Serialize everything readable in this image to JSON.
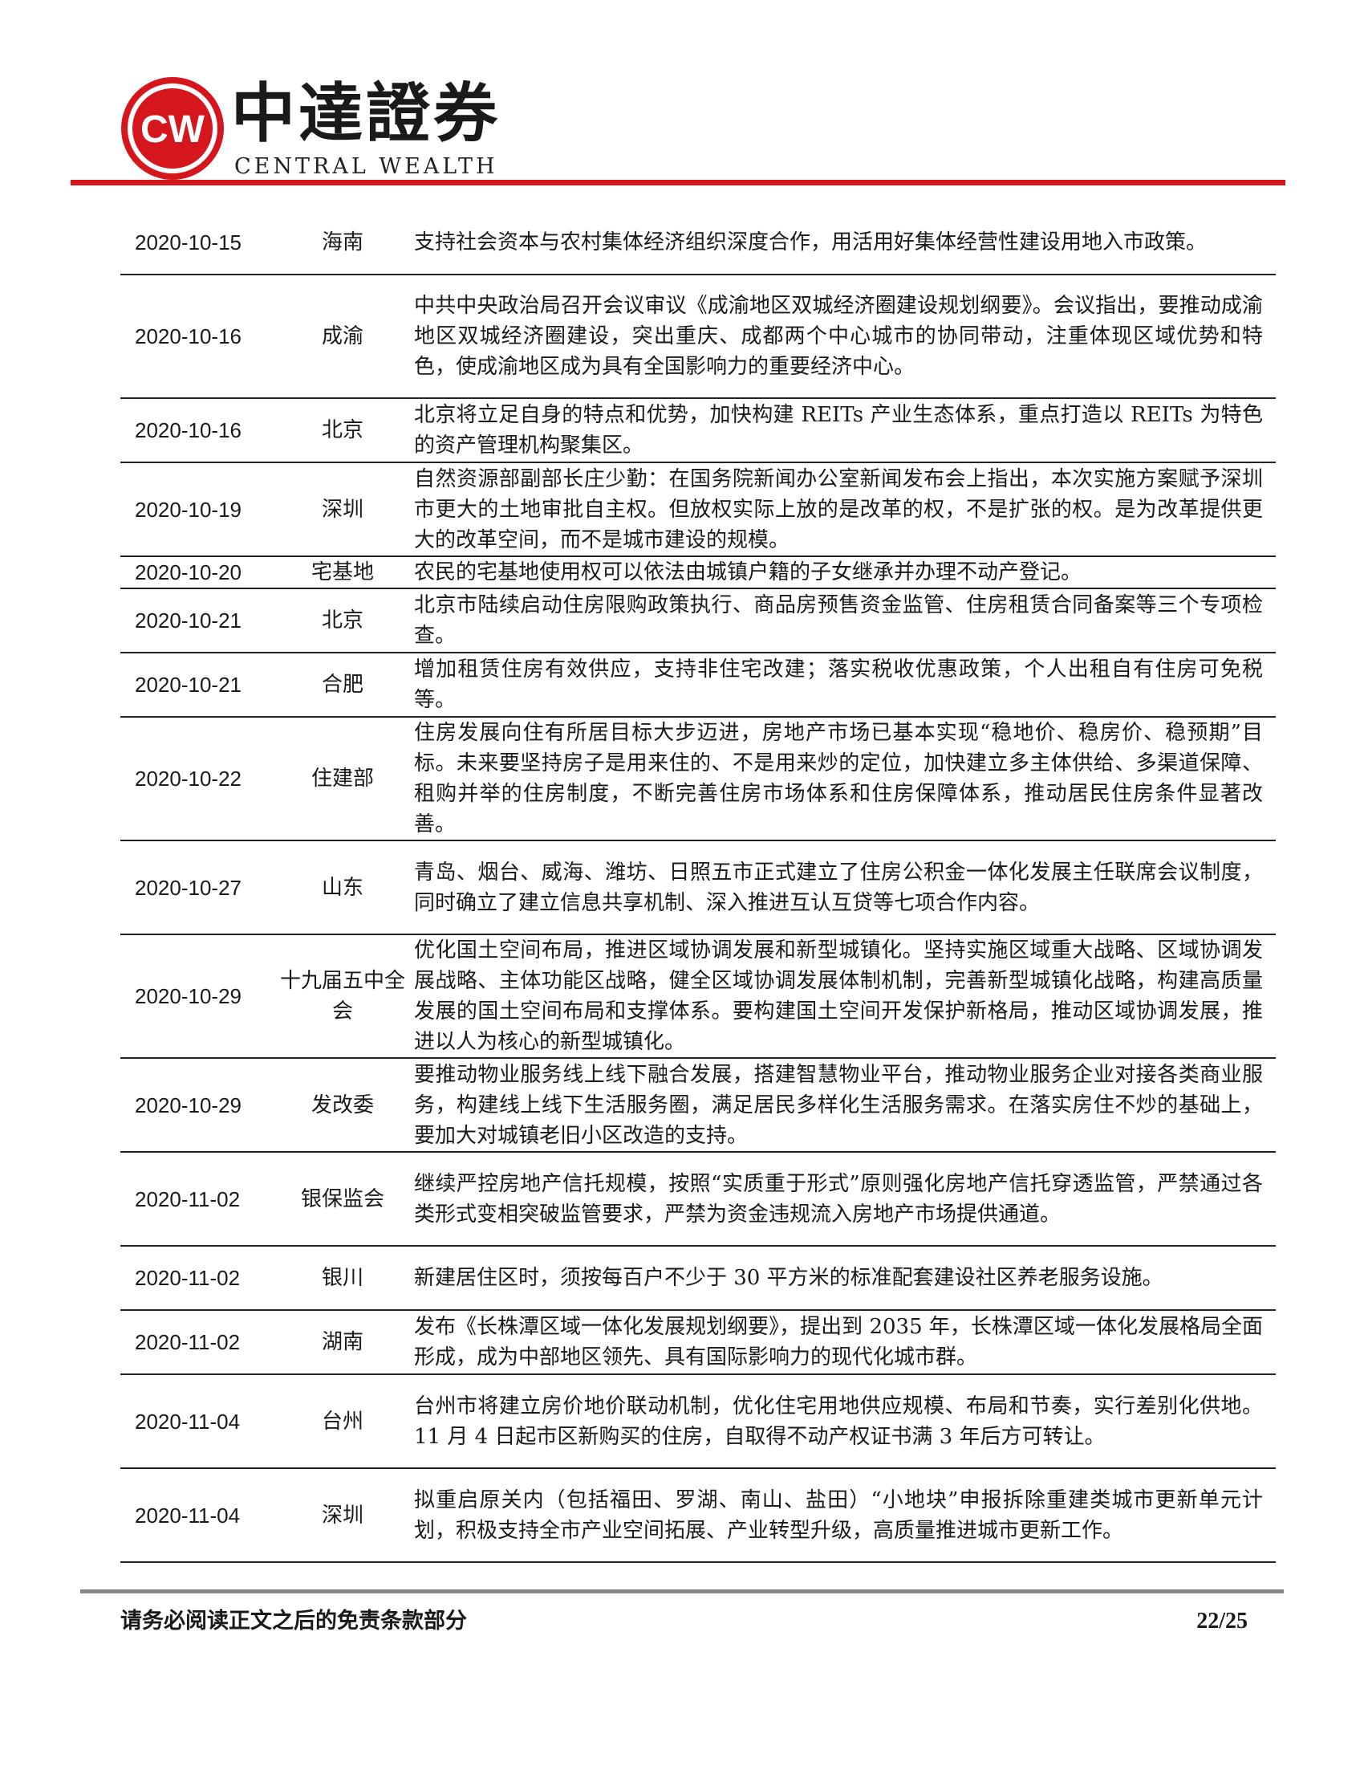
{
  "header": {
    "brand_cn": "中達證券",
    "brand_en": "CENTRAL WEALTH",
    "logo_text": "CW",
    "accent_color": "#d6161d"
  },
  "table": {
    "rows": [
      {
        "date": "2020-10-15",
        "region": "海南",
        "content": "支持社会资本与农村集体经济组织深度合作，用活用好集体经营性建设用地入市政策。"
      },
      {
        "date": "2020-10-16",
        "region": "成渝",
        "content": "中共中央政治局召开会议审议《成渝地区双城经济圈建设规划纲要》。会议指出，要推动成渝地区双城经济圈建设，突出重庆、成都两个中心城市的协同带动，注重体现区域优势和特色，使成渝地区成为具有全国影响力的重要经济中心。"
      },
      {
        "date": "2020-10-16",
        "region": "北京",
        "content": "北京将立足自身的特点和优势，加快构建 REITs 产业生态体系，重点打造以 REITs 为特色的资产管理机构聚集区。"
      },
      {
        "date": "2020-10-19",
        "region": "深圳",
        "content": "自然资源部副部长庄少勤：在国务院新闻办公室新闻发布会上指出，本次实施方案赋予深圳市更大的土地审批自主权。但放权实际上放的是改革的权，不是扩张的权。是为改革提供更大的改革空间，而不是城市建设的规模。"
      },
      {
        "date": "2020-10-20",
        "region": "宅基地",
        "content": "农民的宅基地使用权可以依法由城镇户籍的子女继承并办理不动产登记。"
      },
      {
        "date": "2020-10-21",
        "region": "北京",
        "content": "北京市陆续启动住房限购政策执行、商品房预售资金监管、住房租赁合同备案等三个专项检查。"
      },
      {
        "date": "2020-10-21",
        "region": "合肥",
        "content": "增加租赁住房有效供应，支持非住宅改建；落实税收优惠政策，个人出租自有住房可免税等。"
      },
      {
        "date": "2020-10-22",
        "region": "住建部",
        "content": "住房发展向住有所居目标大步迈进，房地产市场已基本实现“稳地价、稳房价、稳预期”目标。未来要坚持房子是用来住的、不是用来炒的定位，加快建立多主体供给、多渠道保障、租购并举的住房制度，不断完善住房市场体系和住房保障体系，推动居民住房条件显著改善。"
      },
      {
        "date": "2020-10-27",
        "region": "山东",
        "content": "青岛、烟台、威海、潍坊、日照五市正式建立了住房公积金一体化发展主任联席会议制度，同时确立了建立信息共享机制、深入推进互认互贷等七项合作内容。"
      },
      {
        "date": "2020-10-29",
        "region": "十九届五中全会",
        "content": "优化国土空间布局，推进区域协调发展和新型城镇化。坚持实施区域重大战略、区域协调发展战略、主体功能区战略，健全区域协调发展体制机制，完善新型城镇化战略，构建高质量发展的国土空间布局和支撑体系。要构建国土空间开发保护新格局，推动区域协调发展，推进以人为核心的新型城镇化。"
      },
      {
        "date": "2020-10-29",
        "region": "发改委",
        "content": "要推动物业服务线上线下融合发展，搭建智慧物业平台，推动物业服务企业对接各类商业服务，构建线上线下生活服务圈，满足居民多样化生活服务需求。在落实房住不炒的基础上，要加大对城镇老旧小区改造的支持。"
      },
      {
        "date": "2020-11-02",
        "region": "银保监会",
        "content": "继续严控房地产信托规模，按照“实质重于形式”原则强化房地产信托穿透监管，严禁通过各类形式变相突破监管要求，严禁为资金违规流入房地产市场提供通道。"
      },
      {
        "date": "2020-11-02",
        "region": "银川",
        "content": "新建居住区时，须按每百户不少于 30 平方米的标准配套建设社区养老服务设施。"
      },
      {
        "date": "2020-11-02",
        "region": "湖南",
        "content": "发布《长株潭区域一体化发展规划纲要》，提出到 2035 年，长株潭区域一体化发展格局全面形成，成为中部地区领先、具有国际影响力的现代化城市群。"
      },
      {
        "date": "2020-11-04",
        "region": "台州",
        "content": "台州市将建立房价地价联动机制，优化住宅用地供应规模、布局和节奏，实行差别化供地。11 月 4 日起市区新购买的住房，自取得不动产权证书满 3 年后方可转让。"
      },
      {
        "date": "2020-11-04",
        "region": "深圳",
        "content": "拟重启原关内（包括福田、罗湖、南山、盐田）“小地块”申报拆除重建类城市更新单元计划，积极支持全市产业空间拓展、产业转型升级，高质量推进城市更新工作。"
      }
    ]
  },
  "footer": {
    "disclaimer": "请务必阅读正文之后的免责条款部分",
    "page": "22/25"
  }
}
